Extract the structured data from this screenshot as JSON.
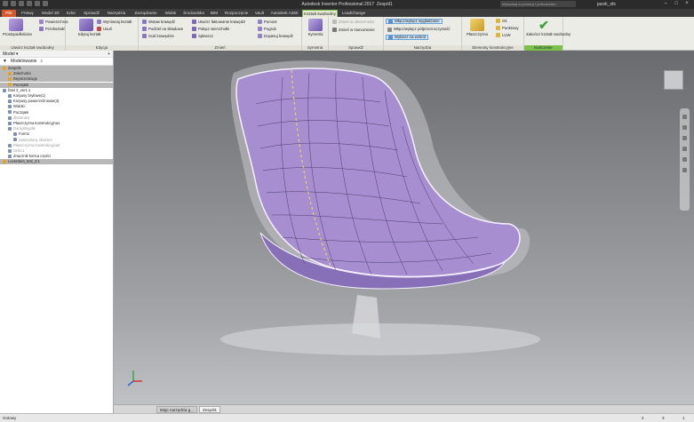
{
  "app": {
    "title": "Autodesk Inventor Professional 2017",
    "document": "Zespół1",
    "search_placeholder": "Wyszukaj w pomocy i poleceniach",
    "user": "jacek_sfs"
  },
  "tabs": [
    "Plik",
    "Fretwy",
    "Model 3D",
    "Szkic",
    "Sprawdź",
    "Narzędzia",
    "Zarządzanie",
    "Widok",
    "Środowiska",
    "BIM",
    "Rozpoczęcie",
    "Vault",
    "Autodesk A360",
    "Kształt swobodny",
    "LoadChange"
  ],
  "ribbon": {
    "tworzenie": {
      "label": "Utwórz kształt swobodny",
      "big": "Prostopadłościan",
      "items": [
        "Powierzchnia",
        "Przekształć"
      ]
    },
    "edycja": {
      "label": "Edycja",
      "big": "Edytuj kształt",
      "items": [
        "Wyrównaj kształt",
        "Usuń"
      ]
    },
    "zmien": {
      "label": "Zmień",
      "col1": [
        "Wstaw krawędź",
        "Podziel na składowe",
        "Scal krawędzie"
      ],
      "col2": [
        "Utwórz faktowanie krawędzi",
        "Połącz wierzchołki",
        "Spłaszcz"
      ],
      "col3": [
        "Pomost",
        "Pogrub",
        "Dopasuj krawędź"
      ]
    },
    "symetria": {
      "label": "Symetria",
      "big": "Symetria"
    },
    "sprawdz": {
      "label": "Sprawdź",
      "items": [
        "Zmień w obszerności",
        "Zmień w stunomienie"
      ]
    },
    "narzedzia": {
      "label": "Narzędzia",
      "items": [
        "Włącz/wyłącz wygładzanie",
        "Włącz/wyłącz półprzezroczystość",
        "Wybierz na wzkrót"
      ]
    },
    "konstrukcyjne": {
      "label": "Elementy konstrukcyjne",
      "big": "Płaszczyzna",
      "items": [
        "Oś",
        "Punktowy",
        "LUW"
      ]
    },
    "konczenie": {
      "label": "Kończenie",
      "big": "Zakończ kształt swobodny"
    }
  },
  "browser": {
    "title": "Model",
    "mode": "Modelowanie",
    "nodes": [
      {
        "label": "Zespół1",
        "style": "gray",
        "indent": 0
      },
      {
        "label": "Zależności",
        "style": "gray",
        "indent": 1
      },
      {
        "label": "Reprezentacje",
        "style": "gray",
        "indent": 1
      },
      {
        "label": "Początek",
        "style": "gray",
        "indent": 1
      },
      {
        "label": "fotel 2_ver1:1",
        "style": "",
        "indent": 0
      },
      {
        "label": "Korpusy bryłowe(1)",
        "style": "",
        "indent": 1
      },
      {
        "label": "Korpusy powierzchniowe(4)",
        "style": "",
        "indent": 1
      },
      {
        "label": "Widoki:",
        "style": "",
        "indent": 1
      },
      {
        "label": "Początek",
        "style": "",
        "indent": 1
      },
      {
        "label": "Złożenie1",
        "style": "dim",
        "indent": 1
      },
      {
        "label": "Płaszczyzna konstrukcyjna1",
        "style": "",
        "indent": 1
      },
      {
        "label": "Domyślnyplik",
        "style": "dim",
        "indent": 1
      },
      {
        "label": "Form1",
        "style": "",
        "indent": 2
      },
      {
        "label": "Zastrzelony obszar4",
        "style": "dim",
        "indent": 2
      },
      {
        "label": "Płaszczyzna konstrukcyjna2",
        "style": "dim",
        "indent": 1
      },
      {
        "label": "Szkic1",
        "style": "dim",
        "indent": 1
      },
      {
        "label": "Znacznik końca części",
        "style": "",
        "indent": 1
      },
      {
        "label": "Leverdent_test_3:1",
        "style": "gray",
        "indent": 0
      }
    ]
  },
  "doc_tabs": [
    "Moje narzędzia g...",
    "Zespół1"
  ],
  "status": {
    "text": "Gotowy",
    "n1": "2",
    "n2": "3",
    "n3": "1"
  },
  "colors": {
    "ribbon_active": "#7cc24a",
    "file_tab": "#d4582b",
    "surface": "#a68ed0"
  }
}
